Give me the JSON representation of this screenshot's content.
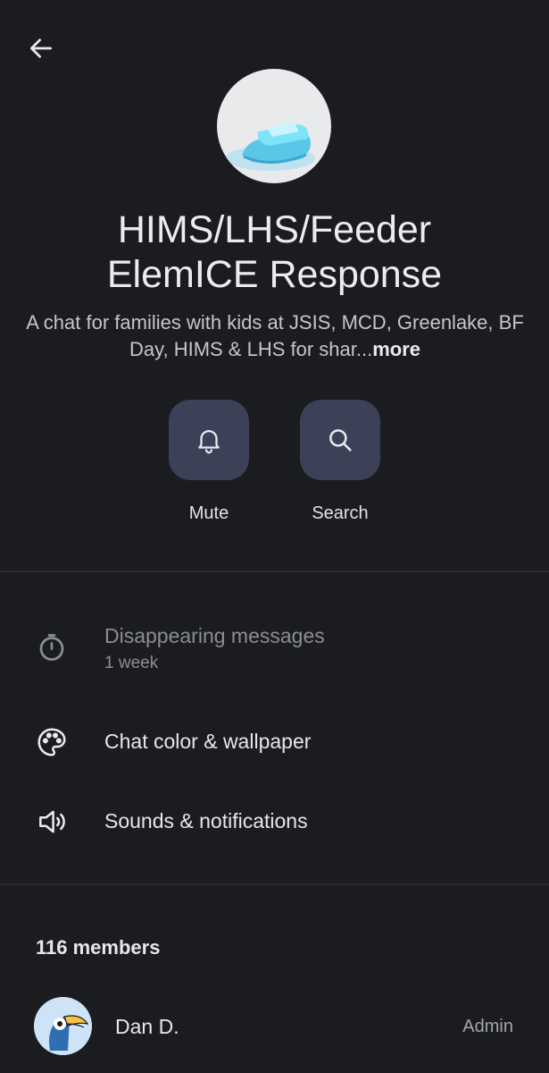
{
  "header": {
    "back_icon": "arrow-left-icon"
  },
  "group": {
    "avatar_icon": "ice-cube-icon",
    "title_line1": "HIMS/LHS/Feeder",
    "title_line2": "ElemICE Response",
    "description": "A chat for families with kids at JSIS, MCD, Greenlake, BF Day, HIMS & LHS for shar...",
    "more_label": "more"
  },
  "actions": {
    "mute": {
      "label": "Mute",
      "icon": "bell-icon"
    },
    "search": {
      "label": "Search",
      "icon": "search-icon"
    }
  },
  "settings": {
    "disappearing": {
      "label": "Disappearing messages",
      "value": "1 week",
      "icon": "timer-icon"
    },
    "chat_color": {
      "label": "Chat color & wallpaper",
      "icon": "palette-icon"
    },
    "sounds": {
      "label": "Sounds & notifications",
      "icon": "speaker-icon"
    }
  },
  "members": {
    "title": "116 members",
    "items": [
      {
        "name": "Dan D.",
        "role": "Admin",
        "avatar_icon": "toucan-icon"
      }
    ]
  },
  "colors": {
    "background": "#1b1c1f",
    "action_bg": "#3c4157",
    "text": "#e9e9ee",
    "muted": "#8b8d94"
  }
}
